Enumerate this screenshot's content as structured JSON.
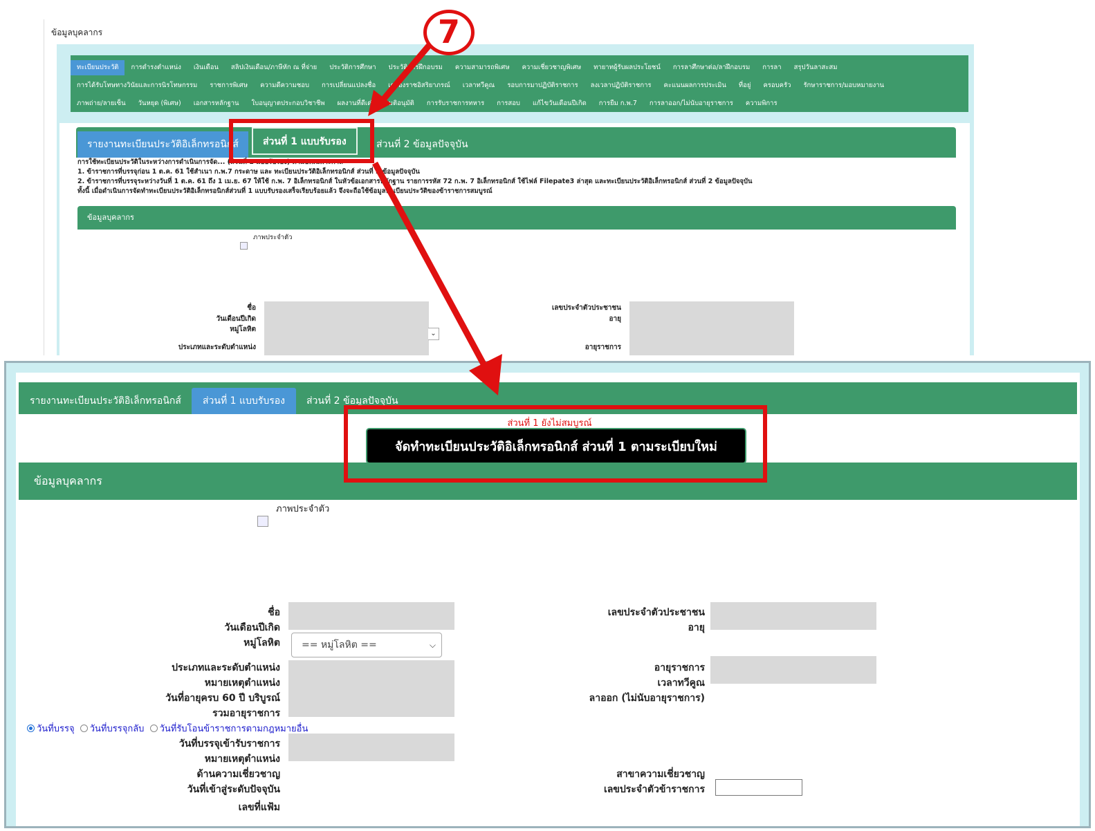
{
  "top": {
    "page_title": "ข้อมูลบุคลากร",
    "menu_rows": [
      [
        "ทะเบียนประวัติ",
        "การดำรงตำแหน่ง",
        "เงินเดือน",
        "สลิปเงินเดือน/ภาษีหัก ณ ที่จ่าย",
        "ประวัติการศึกษา",
        "ประวัติการฝึกอบรม",
        "ความสามารถพิเศษ",
        "ความเชี่ยวชาญพิเศษ",
        "ทายาทผู้รับผลประโยชน์",
        "การลาศึกษาต่อ/ลาฝึกอบรม",
        "การลา",
        "สรุปวันลาสะสม"
      ],
      [
        "การได้รับโทษทางวินัยและการนิรโทษกรรม",
        "ราชการพิเศษ",
        "ความดีความชอบ",
        "การเปลี่ยนแปลงชื่อ",
        "เครื่องราชอิสริยาภรณ์",
        "เวลาทวีคูณ",
        "รอบการมาปฏิบัติราชการ",
        "ลงเวลาปฏิบัติราชการ",
        "คะแนนผลการประเมิน",
        "ที่อยู่",
        "ครอบครัว",
        "รักษาราชการ/มอบหมายงาน"
      ],
      [
        "ภาพถ่าย/ลายเซ็น",
        "วันหยุด (พิเศษ)",
        "เอกสารหลักฐาน",
        "ใบอนุญาตประกอบวิชาชีพ",
        "ผลงานที่ดีเด่น",
        "มติอนุมัติ",
        "การรับราชการทหาร",
        "การสอบ",
        "แก้ไขวันเดือนปีเกิด",
        "การยืม ก.พ.7",
        "การลาออก/ไม่นับอายุราชการ",
        "ความพิการ"
      ]
    ],
    "tabs": {
      "report": "รายงานทะเบียนประวัติอิเล็กทรอนิกส์",
      "part1": "ส่วนที่ 1 แบบรับรอง",
      "part2": "ส่วนที่ 2 ข้อมูลปัจจุบัน"
    },
    "notes": [
      "การใช้ทะเบียนประวัติในระหว่างการดำเนินการจัด... (ส่วนที่ 1 แบบรับรอง) ตามบทเฉพาะกาล",
      "1. ข้าราชการที่บรรจุก่อน 1 ต.ค. 61 ใช้สำเนา ก.พ.7 กระดาษ และ ทะเบียนประวัติอิเล็กทรอนิกส์ ส่วนที่ 2 ข้อมูลปัจจุบัน",
      "2. ข้าราชการที่บรรจุระหว่างวันที่ 1 ต.ค. 61 ถึง 1 เม.ย. 67 ให้ใช้ ก.พ. 7 อิเล็กทรอนิกส์ ในหัวข้อเอกสารหลักฐาน รายการรหัส 72 ก.พ. 7 อิเล็กทรอนิกส์ ใช้ไฟล์ Filepate3 ล่าสุด และทะเบียนประวัติอิเล็กทรอนิกส์ ส่วนที่ 2 ข้อมูลปัจจุบัน",
      "ทั้งนี้ เมื่อดำเนินการจัดทำทะเบียนประวัติอิเล็กทรอนิกส์ส่วนที่ 1 แบบรับรองเสร็จเรียบร้อยแล้ว จึงจะถือใช้ข้อมูลทะเบียนประวัติของข้าราชการสมบูรณ์"
    ],
    "section_title": "ข้อมูลบุคลากร",
    "photo_label": "ภาพประจำตัว",
    "labels_left": [
      "ชื่อ",
      "วันเดือนปีเกิด",
      "หมู่โลหิต",
      "ประเภทและระดับตำแหน่ง"
    ],
    "labels_right": [
      "เลขประจำตัวประชาชน",
      "อายุ",
      "อายุราชการ"
    ]
  },
  "annotation": {
    "step_number": "7",
    "color": "#e01010"
  },
  "bottom": {
    "tabs": {
      "report": "รายงานทะเบียนประวัติอิเล็กทรอนิกส์",
      "part1": "ส่วนที่ 1 แบบรับรอง",
      "part2": "ส่วนที่ 2 ข้อมูลปัจจุบัน"
    },
    "status_text": "ส่วนที่ 1 ยังไม่สมบูรณ์",
    "create_button": "จัดทำทะเบียนประวัติอิเล็กทรอนิกส์ ส่วนที่ 1 ตามระเบียบใหม่",
    "section_title": "ข้อมูลบุคลากร",
    "photo_label": "ภาพประจำตัว",
    "fields_left": {
      "name": "ชื่อ",
      "birthdate": "วันเดือนปีเกิด",
      "blood_type": "หมู่โลหิต",
      "position_type": "ประเภทและระดับตำแหน่ง",
      "position_note": "หมายเหตุตำแหน่ง",
      "retire_date": "วันที่อายุครบ 60 ปี บริบูรณ์",
      "total_service": "รวมอายุราชการ",
      "appoint_date": "วันที่บรรจุเข้ารับราชการ",
      "position_note2": "หมายเหตุตำแหน่ง",
      "expertise": "ด้านความเชี่ยวชาญ",
      "level_date": "วันที่เข้าสู่ระดับปัจจุบัน",
      "file_no": "เลขที่แฟ้ม"
    },
    "fields_right": {
      "citizen_id": "เลขประจำตัวประชาชน",
      "age": "อายุ",
      "service_age": "อายุราชการ",
      "multiplier_time": "เวลาทวีคูณ",
      "leave": "ลาออก (ไม่นับอายุราชการ)",
      "expertise_branch": "สาขาความเชี่ยวชาญ",
      "civil_id": "เลขประจำตัวข้าราชการ"
    },
    "blood_select": {
      "value": "== หมู่โลหิต =="
    },
    "radio_options": [
      "วันที่บรรจุ",
      "วันที่บรรจุกลับ",
      "วันที่รับโอนข้าราชการตามกฎหมายอื่น"
    ],
    "radio_selected": "วันที่บรรจุ"
  }
}
